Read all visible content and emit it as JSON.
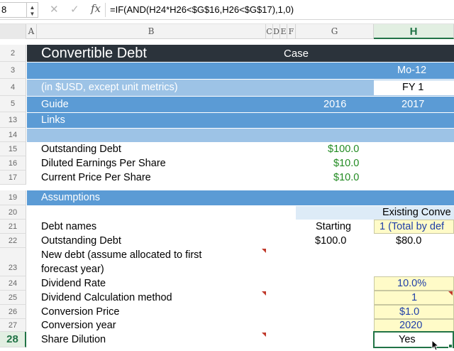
{
  "formula_bar": {
    "name_box": "8",
    "cancel_icon": "✕",
    "enter_icon": "✓",
    "fx_label": "fx",
    "formula": "=IF(AND(H24*H26<$G$16,H26<$G$17),1,0)"
  },
  "columns": [
    "A",
    "B",
    "C",
    "D",
    "E",
    "F",
    "G",
    "H"
  ],
  "rows": {
    "r2": {
      "num": "2",
      "title": "Convertible Debt",
      "case": "Case"
    },
    "r3": {
      "num": "3",
      "h": "Mo-12"
    },
    "r4": {
      "num": "4",
      "b": "(in $USD, except unit metrics)",
      "h": "FY 1"
    },
    "r5": {
      "num": "5",
      "b": "Guide",
      "g": "2016",
      "h": "2017"
    },
    "r13": {
      "num": "13",
      "b": "Links"
    },
    "r14": {
      "num": "14"
    },
    "r15": {
      "num": "15",
      "b": "Outstanding Debt",
      "g": "$100.0"
    },
    "r16": {
      "num": "16",
      "b": "Diluted Earnings Per Share",
      "g": "$10.0"
    },
    "r17": {
      "num": "17",
      "b": "Current Price Per Share",
      "g": "$10.0"
    },
    "r19": {
      "num": "19",
      "b": "Assumptions"
    },
    "r20": {
      "num": "20",
      "h": "Existing Conve"
    },
    "r21": {
      "num": "21",
      "b": "Debt names",
      "g": "Starting",
      "h": "1 (Total by def"
    },
    "r22": {
      "num": "22",
      "b": "Outstanding Debt",
      "g": "$100.0",
      "h": "$80.0"
    },
    "r23": {
      "num": "23",
      "b1": "New debt (assume allocated to first",
      "b2": "forecast year)"
    },
    "r24": {
      "num": "24",
      "b": "Dividend Rate",
      "h": "10.0%"
    },
    "r25": {
      "num": "25",
      "b": "Dividend Calculation method",
      "h": "1"
    },
    "r26": {
      "num": "26",
      "b": "Conversion Price",
      "h": "$1.0"
    },
    "r27": {
      "num": "27",
      "b": "Conversion  year",
      "h": "2020"
    },
    "r28": {
      "num": "28",
      "b": "Share Dilution",
      "h": "Yes"
    }
  },
  "colors": {
    "dark_header": "#2b333b",
    "blue_band": "#5b9bd5",
    "light_blue_band": "#9dc3e6",
    "green_value": "#228b22",
    "input_blue": "#1f3fa8",
    "input_yellow": "#fffbc8",
    "selection_green": "#217346"
  }
}
